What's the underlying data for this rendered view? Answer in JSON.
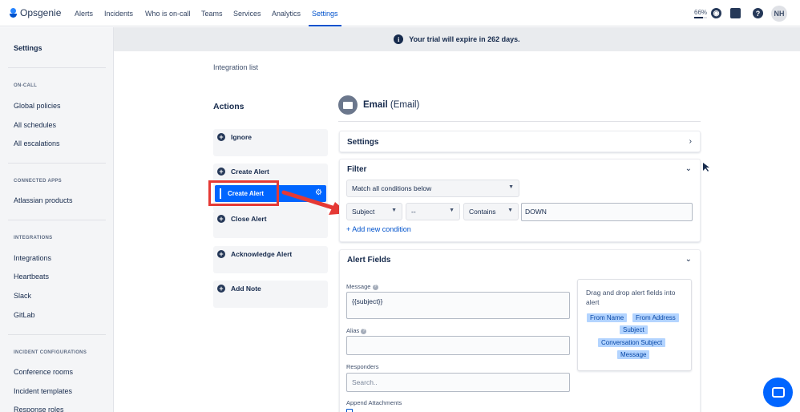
{
  "app": {
    "name": "Opsgenie"
  },
  "nav": {
    "items": [
      "Alerts",
      "Incidents",
      "Who is on-call",
      "Teams",
      "Services",
      "Analytics",
      "Settings"
    ],
    "active": "Settings",
    "progress_label": "66%",
    "progress_value": 0.66,
    "avatar_initials": "NH",
    "icons": [
      "compass-icon",
      "apps-icon",
      "help-icon"
    ]
  },
  "sidebar": {
    "title": "Settings",
    "sections": [
      {
        "heading": "ON-CALL",
        "items": [
          "Global policies",
          "All schedules",
          "All escalations"
        ]
      },
      {
        "heading": "CONNECTED APPS",
        "items": [
          "Atlassian products"
        ]
      },
      {
        "heading": "INTEGRATIONS",
        "items": [
          "Integrations",
          "Heartbeats",
          "Slack",
          "GitLab"
        ]
      },
      {
        "heading": "INCIDENT CONFIGURATIONS",
        "items": [
          "Conference rooms",
          "Incident templates",
          "Response roles"
        ]
      }
    ]
  },
  "banner": {
    "text": "Your trial will expire in 262 days."
  },
  "breadcrumb": "Integration list",
  "actions": {
    "title": "Actions",
    "items": [
      "Ignore",
      "Create Alert",
      "Close Alert",
      "Acknowledge Alert",
      "Add Note"
    ],
    "dragging_label": "Create Alert"
  },
  "integration": {
    "name": "Email",
    "type": "(Email)"
  },
  "settings_panel": {
    "title": "Settings"
  },
  "filter": {
    "title": "Filter",
    "match": "Match all conditions below",
    "condition": {
      "field": "Subject",
      "not_op": "--",
      "operator": "Contains",
      "value": "DOWN"
    },
    "add_condition": "+ Add new condition"
  },
  "alert_fields": {
    "title": "Alert Fields",
    "message_label": "Message",
    "message_value": "{{subject}}",
    "alias_label": "Alias",
    "alias_value": "",
    "responders_label": "Responders",
    "responders_placeholder": "Search..",
    "append_label": "Append Attachments",
    "dnd_text": "Drag and drop alert fields into alert",
    "tags": [
      "From Name",
      "From Address",
      "Subject",
      "Conversation Subject",
      "Message"
    ]
  },
  "colors": {
    "accent": "#0052cc",
    "drag": "#0065ff",
    "highlight": "#e53935"
  }
}
